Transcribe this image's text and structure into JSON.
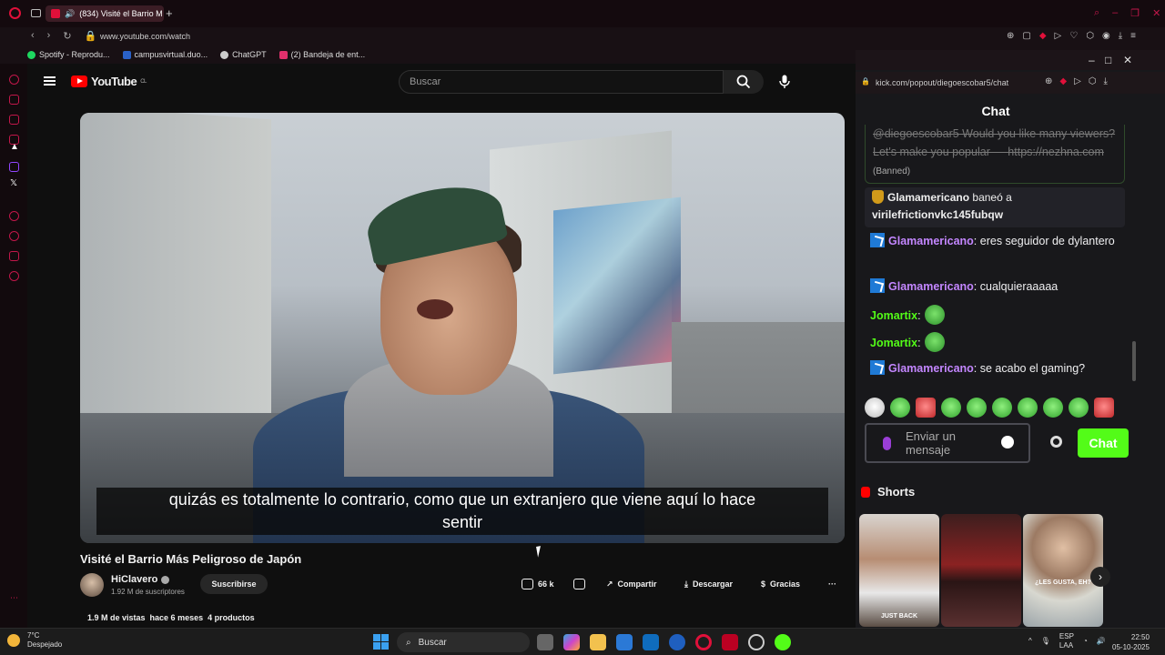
{
  "browser": {
    "tab_title": "(834) Visité el Barrio M",
    "url": "www.youtube.com/watch",
    "bookmarks": [
      {
        "label": "Spotify - Reprodu...",
        "color": "#1ed760"
      },
      {
        "label": "campusvirtual.duo...",
        "color": "#2a61c8"
      },
      {
        "label": "ChatGPT",
        "color": "#cccccc"
      },
      {
        "label": "(2) Bandeja de ent...",
        "color": "#e1306c"
      }
    ]
  },
  "youtube": {
    "logo": "YouTube",
    "region": "CL",
    "search_placeholder": "Buscar",
    "subtitle_line1": "quizás es totalmente lo contrario, como que un extranjero que viene aquí lo hace",
    "subtitle_line2": "sentir",
    "video_title": "Visité el Barrio Más Peligroso de Japón",
    "channel_name": "HiClavero",
    "subscribers": "1.92 M de suscriptores",
    "subscribe_label": "Suscribirse",
    "likes": "66 k",
    "share_label": "Compartir",
    "download_label": "Descargar",
    "thanks_label": "Gracias",
    "more_label": "···",
    "views": "1.9 M de vistas",
    "published": "hace 6 meses",
    "products": "4 productos"
  },
  "chat": {
    "url": "kick.com/popout/diegoescobar5/chat",
    "header": "Chat",
    "banned_message": "@diegoescobar5 Would you like many viewers? Let's make you popular — https://nezhna.com",
    "banned_tag": "(Banned)",
    "mod_action": {
      "user": "Glamamericano",
      "action": "baneó a",
      "target": "virilefrictionvkc145fubqw"
    },
    "messages": [
      {
        "user": "Glamamericano",
        "text": "eres seguidor de dylantero"
      },
      {
        "user": "Glamamericano",
        "text": "cualquieraaaaa"
      },
      {
        "user": "Jomartix",
        "text": ""
      },
      {
        "user": "Jomartix",
        "text": ""
      },
      {
        "user": "Glamamericano",
        "text": "se acabo el gaming?"
      }
    ],
    "input_placeholder": "Enviar un mensaje",
    "send_label": "Chat"
  },
  "shorts": {
    "header": "Shorts",
    "thumbs": [
      {
        "caption": "JUST BACK"
      },
      {
        "caption": ""
      },
      {
        "caption": "¿LES GUSTA, EH?"
      }
    ]
  },
  "taskbar": {
    "temp": "7°C",
    "weather": "Despejado",
    "search": "Buscar",
    "lang": "ESP",
    "lang2": "LAA",
    "time": "22:50",
    "date": "05-10-2025"
  }
}
